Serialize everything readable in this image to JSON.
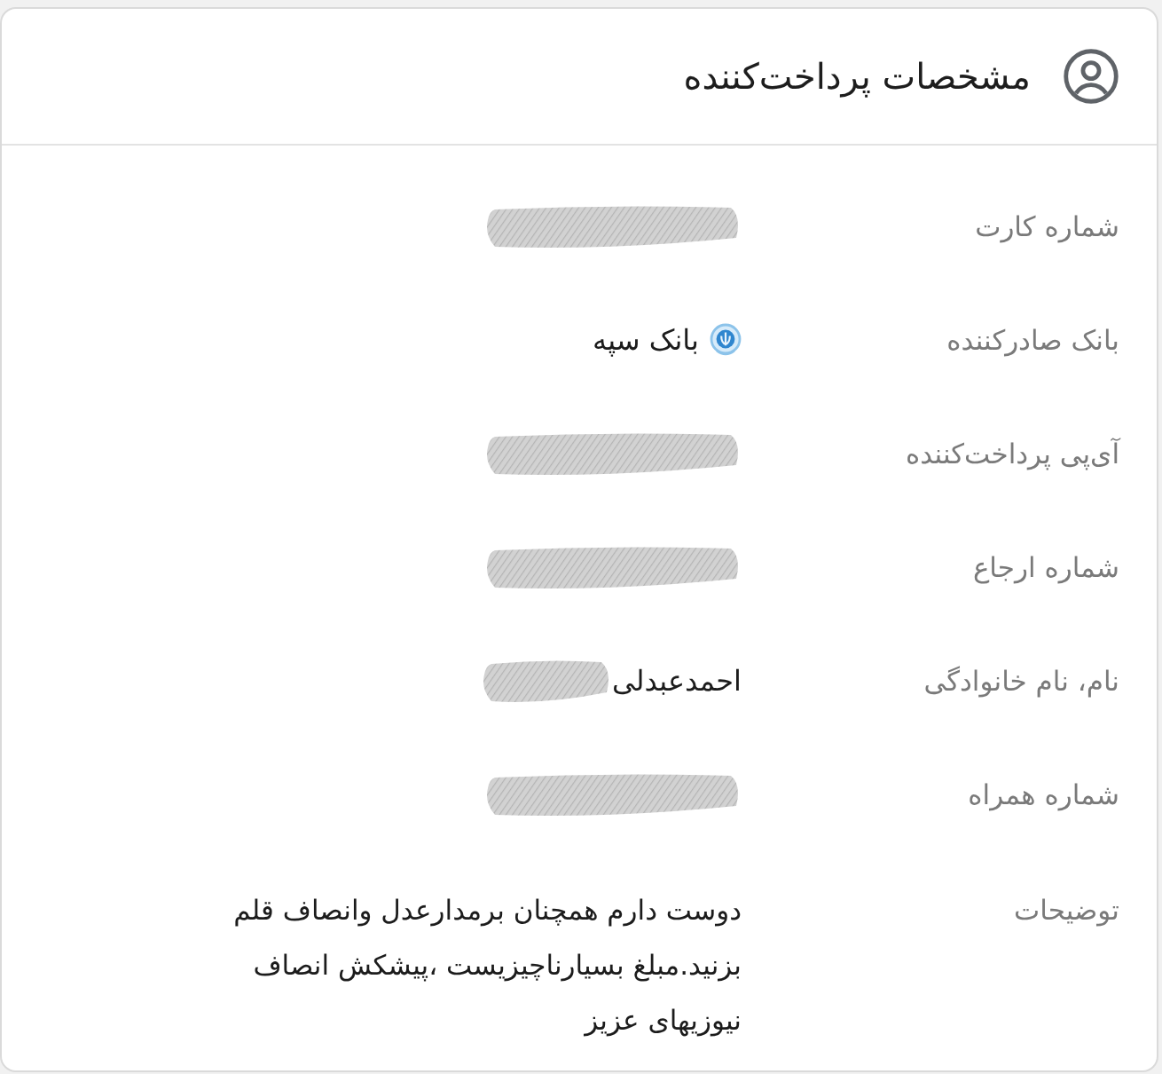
{
  "header": {
    "title": "مشخصات پرداخت‌کننده"
  },
  "fields": [
    {
      "label": "شماره کارت",
      "kind": "text",
      "redacted": true
    },
    {
      "label": "بانک صادرکننده",
      "kind": "bank",
      "value": "بانک سپه",
      "redacted": false
    },
    {
      "label": "آی‌پی پرداخت‌کننده",
      "kind": "text",
      "redacted": true
    },
    {
      "label": "شماره ارجاع",
      "kind": "text",
      "redacted": true
    },
    {
      "label": "نام، نام خانوادگی",
      "kind": "text",
      "value": "احمدعبدلی",
      "redacted": true
    },
    {
      "label": "شماره همراه",
      "kind": "text",
      "redacted": true
    },
    {
      "label": "توضیحات",
      "kind": "note",
      "value": "دوست دارم همچنان برمدارعدل وانصاف قلم بزنید.مبلغ بسیارناچیزیست ،پیشکش انصاف نیوزیهای عزیز",
      "redacted": false
    }
  ]
}
